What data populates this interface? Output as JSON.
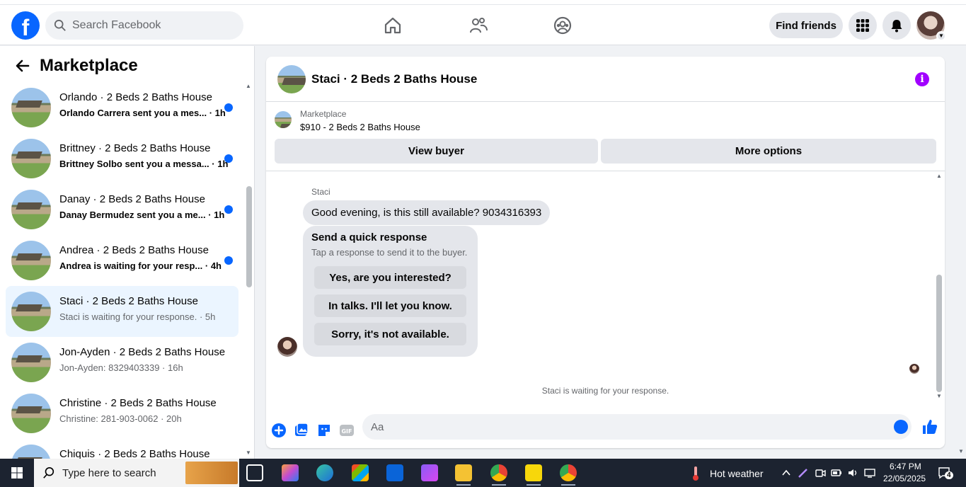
{
  "topbar": {
    "logo": "f",
    "search_placeholder": "Search Facebook",
    "find_friends": "Find friends"
  },
  "sidebar": {
    "title": "Marketplace",
    "conversations": [
      {
        "title": "Orlando · 2 Beds 2 Baths House",
        "sub": "Orlando Carrera sent you a mes... · 1h",
        "unread": true
      },
      {
        "title": "Brittney · 2 Beds 2 Baths House",
        "sub": "Brittney Solbo sent you a messa... · 1h",
        "unread": true
      },
      {
        "title": "Danay · 2 Beds 2 Baths House",
        "sub": "Danay Bermudez sent you a me... · 1h",
        "unread": true
      },
      {
        "title": "Andrea · 2 Beds 2 Baths House",
        "sub": "Andrea is waiting for your resp... · 4h",
        "unread": true
      },
      {
        "title": "Staci · 2 Beds 2 Baths House",
        "sub": "Staci is waiting for your response. · 5h",
        "unread": false,
        "active": true
      },
      {
        "title": "Jon-Ayden · 2 Beds 2 Baths House",
        "sub": "Jon-Ayden: 8329403339 · 16h",
        "unread": false
      },
      {
        "title": "Christine · 2 Beds 2 Baths House",
        "sub": "Christine: 281-903-0062 · 20h",
        "unread": false
      },
      {
        "title": "Chiquis · 2 Beds 2 Baths House",
        "sub": "",
        "unread": false
      }
    ]
  },
  "chat": {
    "title": "Staci · 2 Beds 2 Baths House",
    "marketplace_label": "Marketplace",
    "listing": "$910 - 2 Beds 2 Baths House",
    "view_buyer": "View buyer",
    "more_options": "More options",
    "sender": "Staci",
    "message": "Good evening, is this still available? 9034316393",
    "quick_title": "Send a quick response",
    "quick_sub": "Tap a response to send it to the buyer.",
    "quick_responses": [
      "Yes, are you interested?",
      "In talks. I'll let you know.",
      "Sorry, it's not available."
    ],
    "waiting": "Staci is waiting for your response.",
    "input_placeholder": "Aa"
  },
  "taskbar": {
    "search_placeholder": "Type here to search",
    "weather": "Hot weather",
    "time": "6:47 PM",
    "date": "22/05/2025",
    "notifications": "4"
  },
  "colors": {
    "brand": "#0866ff",
    "info": "#a100ff",
    "unread_dot": "#0866ff"
  }
}
